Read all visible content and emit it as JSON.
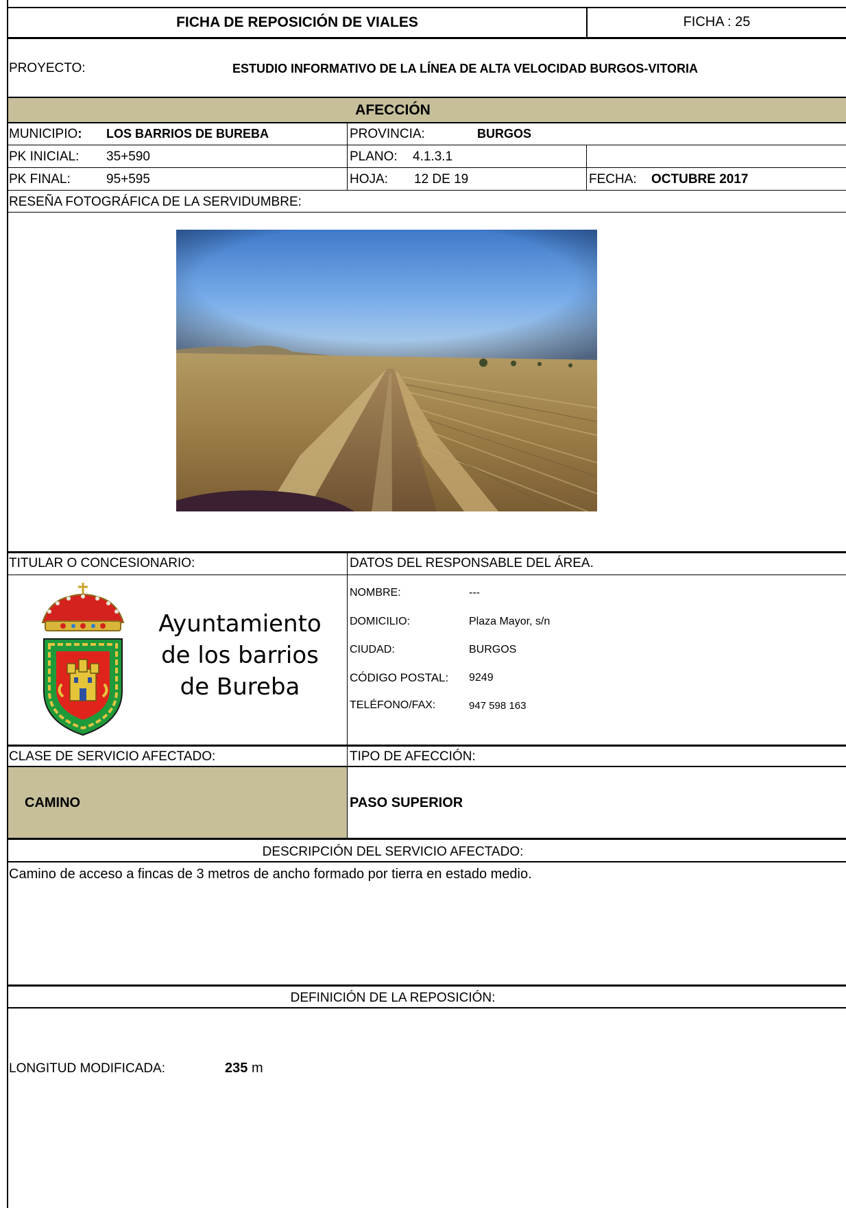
{
  "header": {
    "title": "FICHA DE REPOSICIÓN DE VIALES",
    "ficha": "FICHA : 25"
  },
  "proyecto": {
    "label": "PROYECTO:",
    "value": "ESTUDIO INFORMATIVO DE LA LÍNEA DE ALTA VELOCIDAD BURGOS-VITORIA"
  },
  "afeccion": {
    "heading": "AFECCIÓN",
    "municipio_label": "MUNICIPIO",
    "municipio_colon": ":",
    "municipio_value": "LOS BARRIOS DE BUREBA",
    "provincia_label": "PROVINCIA:",
    "provincia_value": "BURGOS",
    "pk_inicial_label": "PK INICIAL:",
    "pk_inicial_value": "35+590",
    "plano_label": "PLANO:",
    "plano_value": "4.1.3.1",
    "pk_final_label": "PK FINAL:",
    "pk_final_value": "95+595",
    "hoja_label": "HOJA:",
    "hoja_value": "12 DE 19",
    "fecha_label": "FECHA:",
    "fecha_value": "OCTUBRE 2017"
  },
  "resena": {
    "label": "RESEÑA FOTOGRÁFICA DE LA SERVIDUMBRE:"
  },
  "titular": {
    "label": "TITULAR O CONCESIONARIO:",
    "line1": "Ayuntamiento",
    "line2": "de los barrios",
    "line3": "de Bureba"
  },
  "responsable": {
    "label": "DATOS DEL RESPONSABLE DEL ÁREA.",
    "nombre_label": "NOMBRE:",
    "nombre_value": "---",
    "domicilio_label": "DOMICILIO:",
    "domicilio_value": "Plaza Mayor, s/n",
    "ciudad_label": "CIUDAD:",
    "ciudad_value": "BURGOS",
    "cp_label": "CÓDIGO POSTAL:",
    "cp_value": "9249",
    "tel_label": "TELÉFONO/FAX:",
    "tel_value": "947 598 163"
  },
  "servicio": {
    "clase_label": "CLASE DE SERVICIO AFECTADO:",
    "clase_value": "CAMINO",
    "tipo_label": "TIPO DE AFECCIÓN:",
    "tipo_value": "PASO SUPERIOR"
  },
  "descripcion": {
    "heading": "DESCRIPCIÓN DEL SERVICIO AFECTADO:",
    "text": "Camino de acceso a fincas de 3 metros de ancho formado por tierra en estado medio."
  },
  "definicion": {
    "heading": "DEFINICIÓN DE LA REPOSICIÓN:",
    "longitud_label": "LONGITUD MODIFICADA:",
    "longitud_value": "235",
    "longitud_unit": "m"
  },
  "colors": {
    "band": "#c6bf9a",
    "border": "#000000"
  }
}
